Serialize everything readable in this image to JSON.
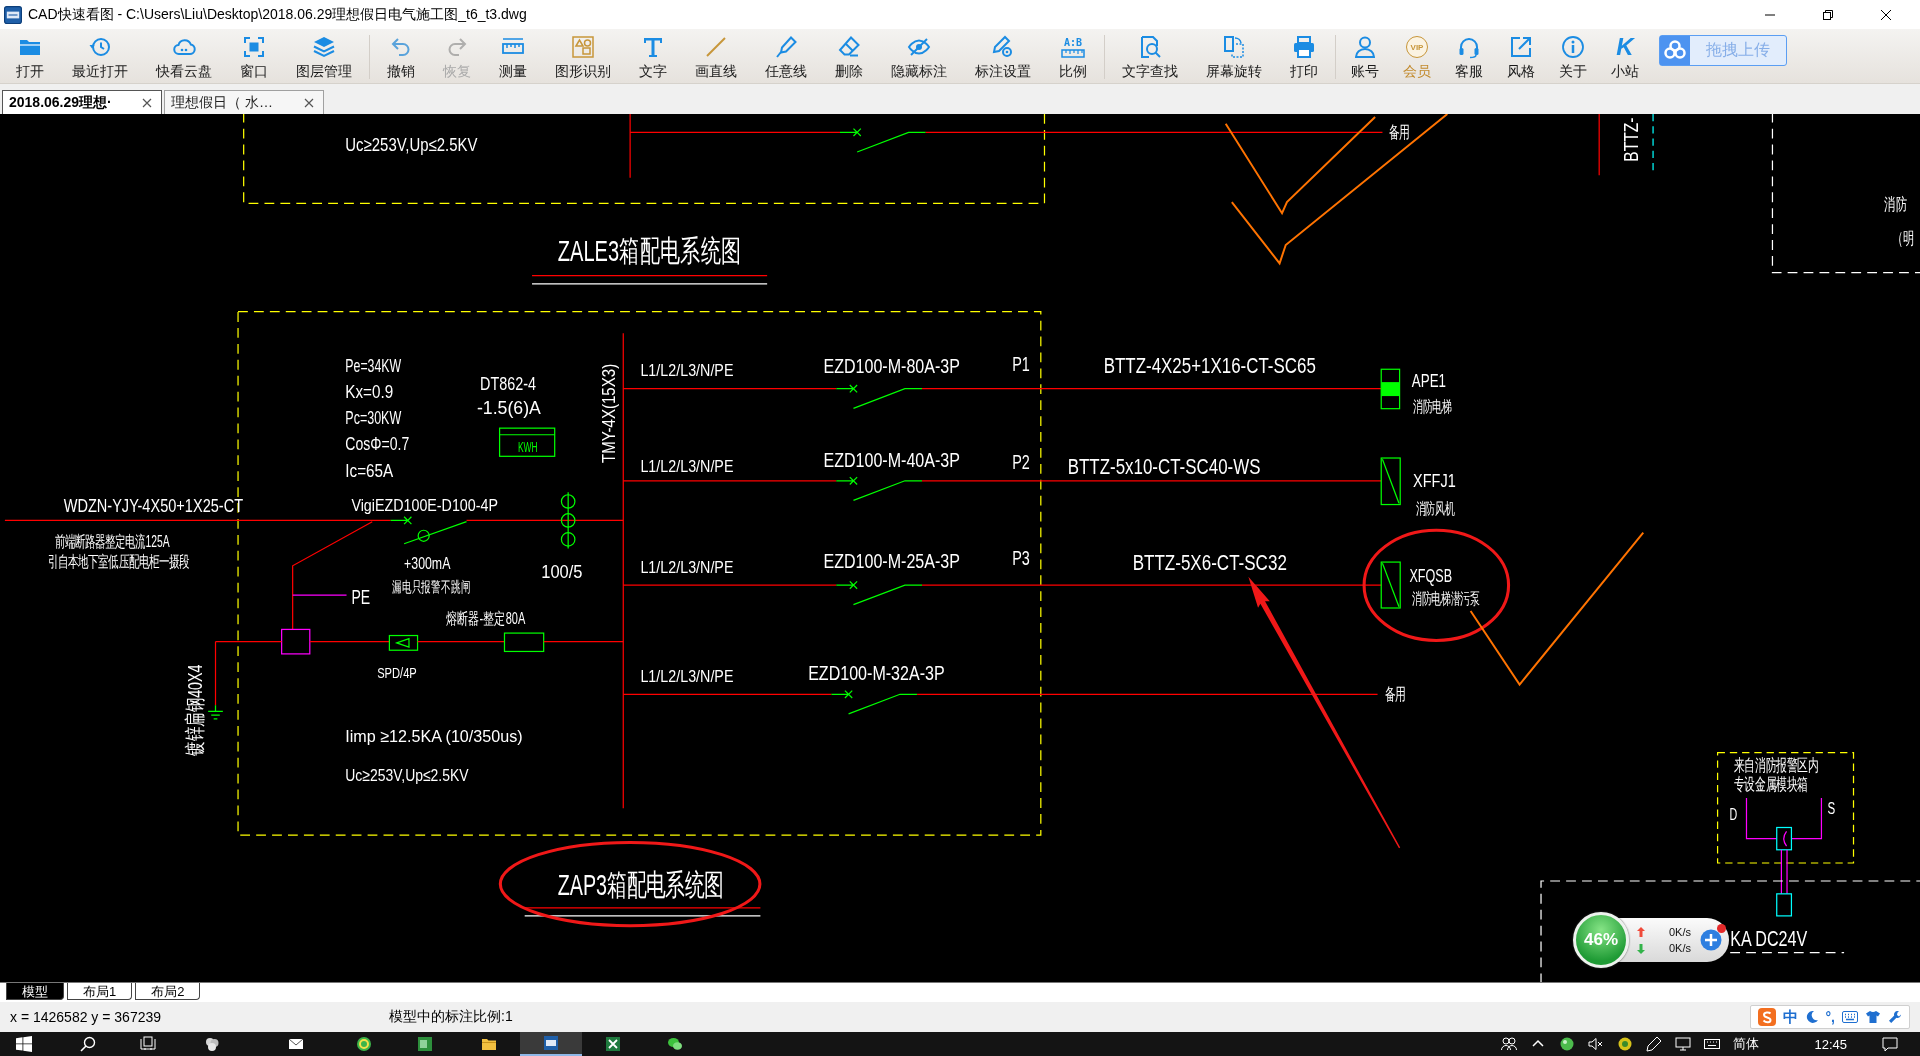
{
  "window": {
    "title": "CAD快速看图 - C:\\Users\\Liu\\Desktop\\2018.06.29理想假日电气施工图_t6_t3.dwg"
  },
  "toolbar": {
    "groups": [
      {
        "items": [
          {
            "label": "打开",
            "kind": "tool",
            "disabled": false
          },
          {
            "label": "最近打开",
            "kind": "tool",
            "disabled": false
          },
          {
            "label": "快看云盘",
            "kind": "tool",
            "disabled": false
          },
          {
            "label": "窗口",
            "kind": "tool",
            "disabled": false
          },
          {
            "label": "图层管理",
            "kind": "tool",
            "disabled": false
          }
        ]
      },
      {
        "items": [
          {
            "label": "撤销",
            "kind": "tool",
            "disabled": false
          },
          {
            "label": "恢复",
            "kind": "tool",
            "disabled": true
          },
          {
            "label": "测量",
            "kind": "tool",
            "disabled": false
          },
          {
            "label": "图形识别",
            "kind": "tool",
            "disabled": false
          },
          {
            "label": "文字",
            "kind": "tool",
            "disabled": false
          },
          {
            "label": "画直线",
            "kind": "tool",
            "disabled": false
          },
          {
            "label": "任意线",
            "kind": "tool",
            "disabled": false
          },
          {
            "label": "删除",
            "kind": "tool",
            "disabled": false
          },
          {
            "label": "隐藏标注",
            "kind": "tool",
            "disabled": false
          },
          {
            "label": "标注设置",
            "kind": "tool",
            "disabled": false
          },
          {
            "label": "比例",
            "kind": "tool",
            "disabled": false,
            "icon_text": "A:B"
          }
        ]
      },
      {
        "items": [
          {
            "label": "文字查找",
            "kind": "tool",
            "disabled": false
          },
          {
            "label": "屏幕旋转",
            "kind": "tool",
            "disabled": false
          },
          {
            "label": "打印",
            "kind": "tool",
            "disabled": false
          }
        ]
      },
      {
        "items": [
          {
            "label": "账号",
            "kind": "tool",
            "disabled": false
          },
          {
            "label": "会员",
            "kind": "vip",
            "disabled": false,
            "icon_text": "VIP"
          },
          {
            "label": "客服",
            "kind": "tool",
            "disabled": false
          },
          {
            "label": "风格",
            "kind": "tool",
            "disabled": false
          },
          {
            "label": "关于",
            "kind": "tool",
            "disabled": false
          },
          {
            "label": "小站",
            "kind": "tool",
            "disabled": false,
            "icon_text": "K"
          }
        ]
      }
    ],
    "upload_button": "拖拽上传"
  },
  "tabs": [
    {
      "label": "2018.06.29理想·",
      "selected": true
    },
    {
      "label": "理想假日（ 水…",
      "selected": false
    }
  ],
  "drawing": {
    "upper_panel": {
      "rating": "Uc≥253V,Up≤2.5KV",
      "spare": "备用"
    },
    "upper_title": "ZALE3箱配电系统图",
    "riser_cable": "BTTZ-",
    "side_panel": {
      "lines": [
        "消防",
        "（明"
      ]
    },
    "panel": {
      "feeder_cable": "WDZN-YJY-4X50+1X25-CT",
      "feeder_notes": [
        "前端断路器整定电流125A",
        "引自本地下室低压配电柜一摄段"
      ],
      "load_data": [
        "Pe=34KW",
        "Kx=0.9",
        "Pc=30KW",
        "CosΦ=0.7",
        "Ic=65A"
      ],
      "meter_model": [
        "DT862-4",
        "-1.5(6)A"
      ],
      "meter_label": "KWH",
      "busbar": "TMY-4X(15X3)",
      "main_breaker": "VigiEZD100E-D100-4P",
      "leakage_current": "+300mA",
      "ct_ratio": "100/5",
      "pe_label": "PE",
      "leakage_note": "漏电只报警不跳闸",
      "fuse_note": "熔断器-整定80A",
      "spd_label": "SPD/4P",
      "earthing": "镀锌扁钢40X4",
      "spd_ratings": [
        "Iimp ≥12.5KA (10/350us)",
        "Uc≥253V,Up≤2.5KV"
      ],
      "circuits": [
        {
          "kind": "distribution_box",
          "phases": "L1/L2/L3/N/PE",
          "breaker": "EZD100-M-80A-3P",
          "circuit": "P1",
          "cable": "BTTZ-4X25+1X16-CT-SC65",
          "load_code": "APE1",
          "load_name": "消防电梯"
        },
        {
          "kind": "equipment",
          "phases": "L1/L2/L3/N/PE",
          "breaker": "EZD100-M-40A-3P",
          "circuit": "P2",
          "cable": "BTTZ-5x10-CT-SC40-WS",
          "load_code": "XFFJ1",
          "load_name": "消防风机"
        },
        {
          "kind": "equipment",
          "phases": "L1/L2/L3/N/PE",
          "breaker": "EZD100-M-25A-3P",
          "circuit": "P3",
          "cable": "BTTZ-5X6-CT-SC32",
          "load_code": "XFQSB",
          "load_name": "消防电梯潜污泵"
        },
        {
          "kind": "spare",
          "phases": "L1/L2/L3/N/PE",
          "breaker": "EZD100-M-32A-3P",
          "spare": "备用"
        }
      ],
      "title": "ZAP3箱配电系统图"
    },
    "module_box": {
      "lines": [
        "来自消防报警区内",
        "专设金属模块箱"
      ],
      "left_terminal": "D",
      "right_terminal": "S"
    },
    "relay_label": "KA DC24V"
  },
  "speed_widget": {
    "load": "46%",
    "upload": "0K/s",
    "download": "0K/s"
  },
  "layout_tabs": [
    {
      "label": "模型",
      "selected": true
    },
    {
      "label": "布局1",
      "selected": false
    },
    {
      "label": "布局2",
      "selected": false
    }
  ],
  "status_bar": {
    "coordinates": "x = 1426582 y = 367239",
    "annotation_scale": "模型中的标注比例:1"
  },
  "ime_bar": {
    "mode": "中",
    "punctuation": "°,"
  },
  "taskbar": {
    "apps": [
      {
        "selected": false
      },
      {
        "selected": false
      },
      {
        "selected": false
      },
      {
        "selected": false
      },
      {
        "selected": false
      },
      {
        "selected": true
      },
      {
        "selected": false
      },
      {
        "selected": false
      }
    ],
    "input_language": "简体",
    "clock": "12:45"
  }
}
